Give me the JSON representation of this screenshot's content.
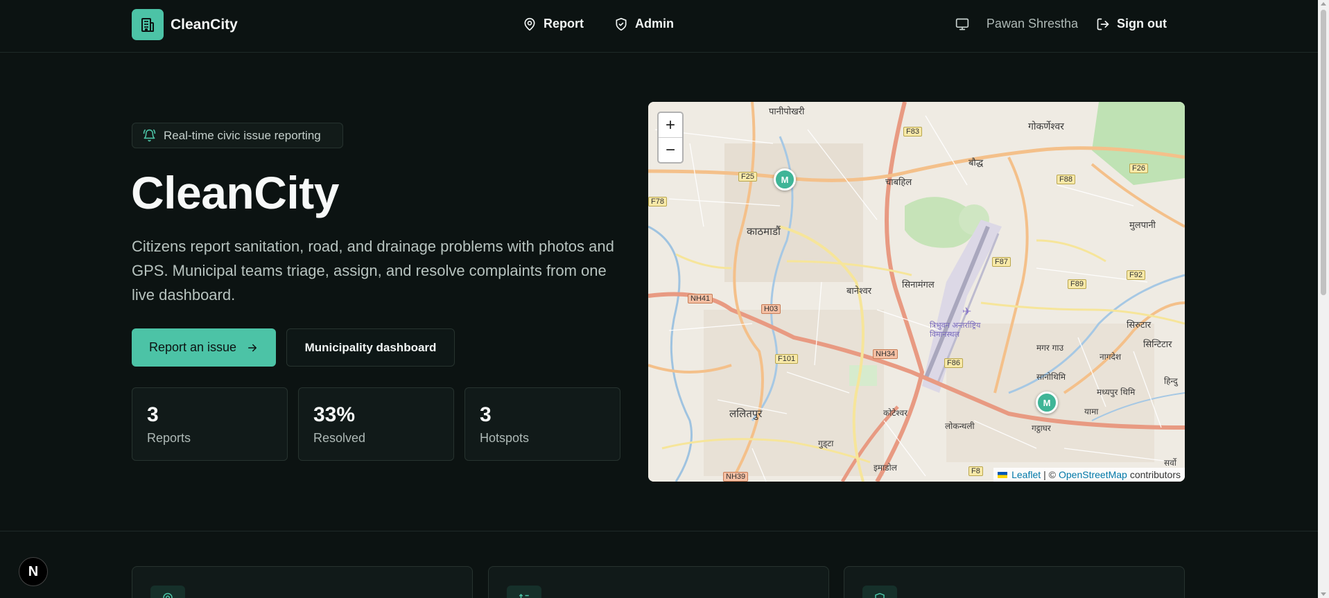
{
  "header": {
    "brand": "CleanCity",
    "nav": [
      {
        "label": "Report",
        "icon": "map-pin-icon"
      },
      {
        "label": "Admin",
        "icon": "shield-icon"
      }
    ],
    "user_name": "Pawan Shrestha",
    "sign_out": "Sign out"
  },
  "hero": {
    "pill": "Real-time civic issue reporting",
    "title": "CleanCity",
    "description": "Citizens report sanitation, road, and drainage problems with photos and GPS. Municipal teams triage, assign, and resolve complaints from one live dashboard.",
    "primary_button": "Report an issue",
    "secondary_button": "Municipality dashboard"
  },
  "stats": [
    {
      "value": "3",
      "label": "Reports"
    },
    {
      "value": "33%",
      "label": "Resolved"
    },
    {
      "value": "3",
      "label": "Hotspots"
    }
  ],
  "map": {
    "zoom_in": "+",
    "zoom_out": "−",
    "markers": [
      {
        "label": "M"
      },
      {
        "label": "M"
      }
    ],
    "places": [
      "पानीपोखरी",
      "गोकर्णेश्वर",
      "बौद्ध",
      "चाबहिल",
      "काठमाडौं",
      "मुलपानी",
      "सिनामंगल",
      "बानेश्वर",
      "त्रिभुवन अन्तर्राष्ट्रिय विमानस्थल",
      "सिरुटार",
      "सिन्टिटार",
      "मगर गाउ",
      "नागदेश",
      "सानोथिमि",
      "मध्यपुर थिमि",
      "यामा",
      "ललितपुर",
      "कोटेश्वर",
      "लोकन्थली",
      "गट्ठाघर",
      "गुड्टा",
      "इमाडोल",
      "हिन्दु",
      "सर्वो"
    ],
    "road_tags": [
      "F83",
      "F25",
      "F78",
      "F88",
      "F26",
      "F87",
      "F92",
      "F89",
      "NH41",
      "H03",
      "NH34",
      "F86",
      "F101",
      "NH39",
      "F8"
    ],
    "attribution_leaflet": "Leaflet",
    "attribution_sep": "| ©",
    "attribution_osm": "OpenStreetMap",
    "attribution_rest": "contributors"
  },
  "colors": {
    "accent": "#4cc3a6",
    "background": "#0c1312",
    "card": "#111a19"
  },
  "next_badge": "N"
}
